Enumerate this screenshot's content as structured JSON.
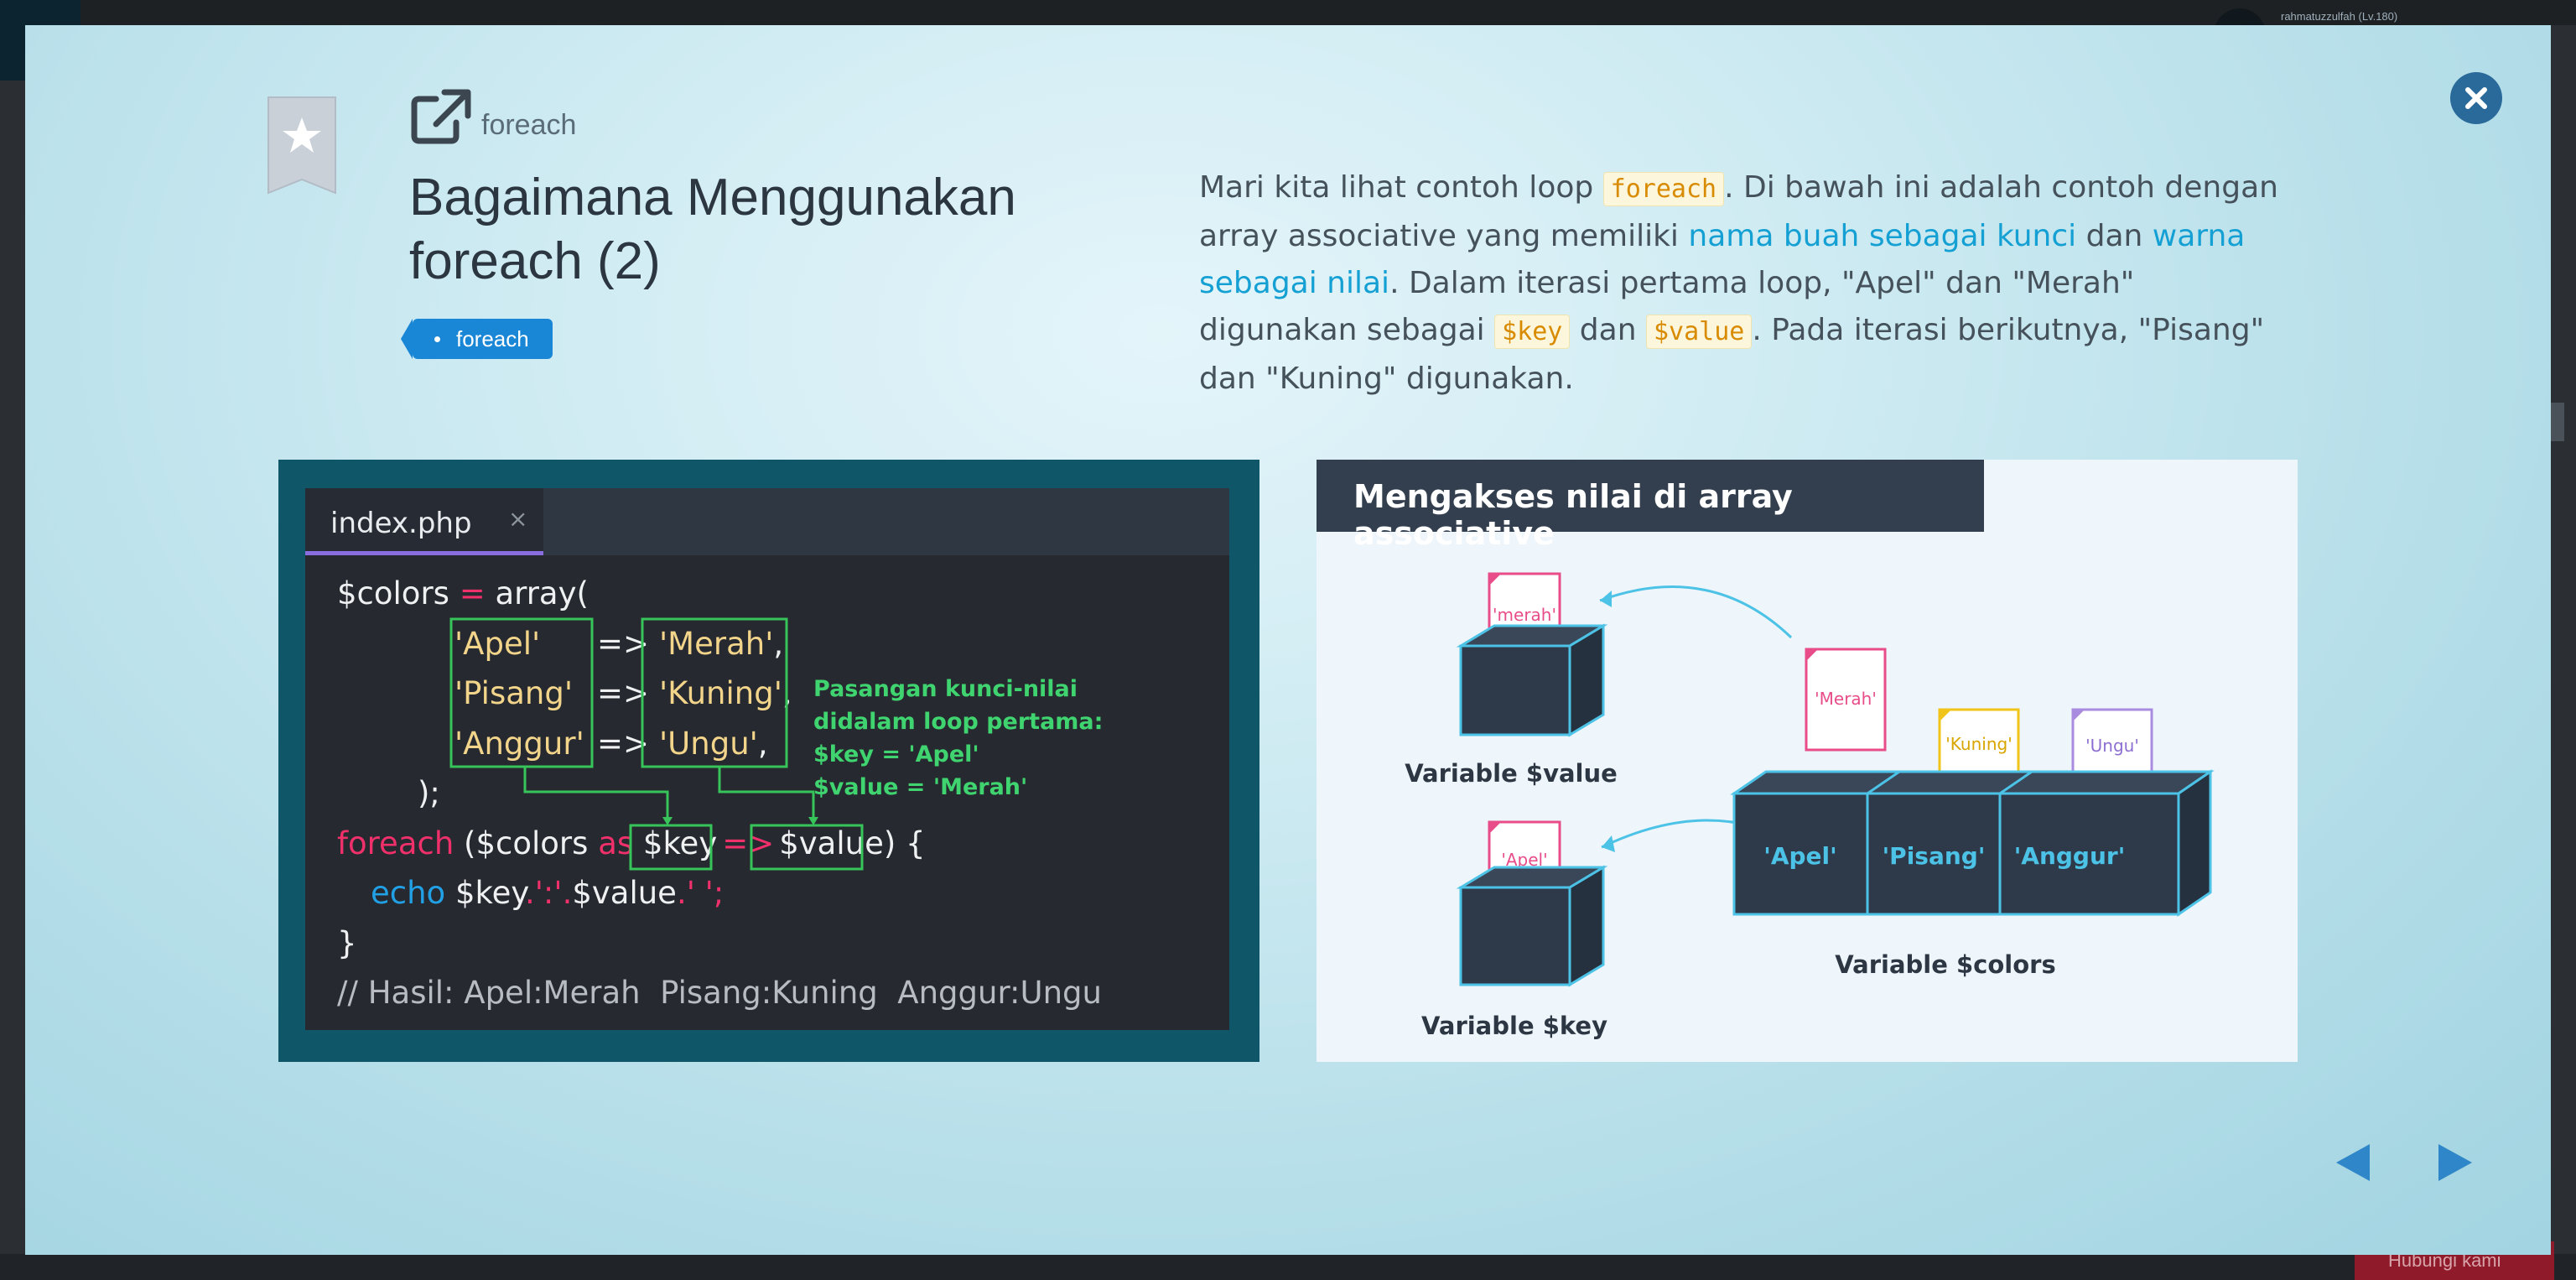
{
  "background": {
    "username": "rahmatuzzulfah (Lv.180)",
    "footer_button": "Hubungi kami"
  },
  "lesson": {
    "topic": "foreach",
    "title_line1": "Bagaimana Menggunakan",
    "title_line2": "foreach (2)",
    "tag": "foreach"
  },
  "description": {
    "p1": "Mari kita lihat contoh loop ",
    "code1": "foreach",
    "p2": ". Di bawah ini adalah contoh dengan array associative yang memiliki ",
    "hl1": "nama buah sebagai kunci",
    "p3": " dan ",
    "hl2": "warna sebagai nilai",
    "p4": ". Dalam iterasi pertama loop, \"Apel\" dan \"Merah\" digunakan sebagai ",
    "code2": "$key",
    "p5": " dan ",
    "code3": "$value",
    "p6": ". Pada iterasi berikutnya, \"Pisang\" dan \"Kuning\" digunakan."
  },
  "code_example": {
    "filename": "index.php",
    "tab_close": "×",
    "line1_var": "$colors",
    "line1_eq": " = ",
    "line1_fn": "array(",
    "rows": [
      {
        "key": "'Apel'",
        "arrow": "=>",
        "value": "'Merah'",
        "sep": ","
      },
      {
        "key": "'Pisang'",
        "arrow": "=>",
        "value": "'Kuning'",
        "sep": ","
      },
      {
        "key": "'Anggur'",
        "arrow": "=>",
        "value": "'Ungu'",
        "sep": ","
      }
    ],
    "close_array": ");",
    "foreach_kw": "foreach",
    "foreach_open": " ($colors ",
    "as_kw": "as",
    "key_var": "$key",
    "arrow2": "=>",
    "value_var": "$value",
    "foreach_close": ") {",
    "echo_kw": "echo",
    "echo_a": " $key",
    "echo_b": ".':'.",
    "echo_c": "$value",
    "echo_d": ".' ';",
    "brace_close": "}",
    "comment": "// Hasil: Apel:Merah  Pisang:Kuning  Anggur:Ungu",
    "note_lines": [
      "Pasangan kunci-nilai",
      "didalam loop pertama:",
      "$key = 'Apel'",
      "$value = 'Merah'"
    ]
  },
  "diagram": {
    "title": "Mengakses nilai di array associative",
    "value_card": "'merah'",
    "value_label": "Variable $value",
    "key_card": "'Apel'",
    "key_label": "Variable $key",
    "floating_card": "'Merah'",
    "array_cards": [
      "'Kuning'",
      "'Ungu'"
    ],
    "array_keys": [
      "'Apel'",
      "'Pisang'",
      "'Anggur'"
    ],
    "array_label": "Variable $colors",
    "colors": {
      "pink": "#e84d8a",
      "yellow": "#f0c419",
      "purple": "#a98ce0",
      "box": "#2e3a4a",
      "box_edge": "#4cc3e6"
    }
  }
}
